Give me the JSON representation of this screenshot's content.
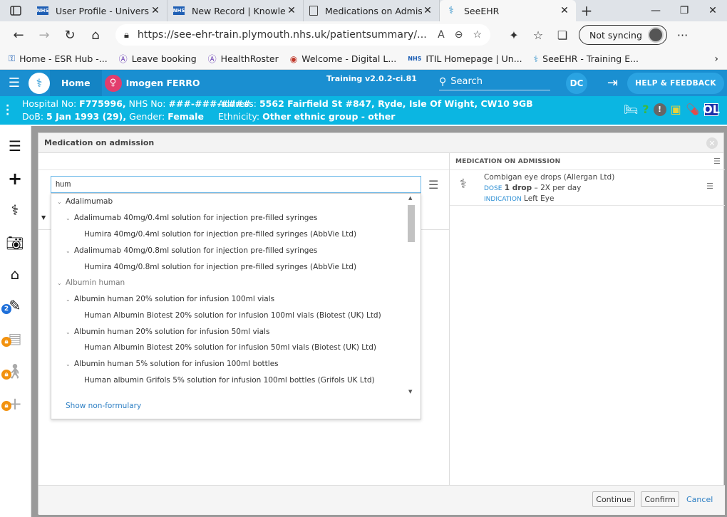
{
  "browser": {
    "tabs": [
      {
        "title": "User Profile - University",
        "favicon": "NHS",
        "active": false
      },
      {
        "title": "New Record | Knowledg",
        "favicon": "NHS",
        "active": false
      },
      {
        "title": "Medications on Admiss",
        "favicon": "doc",
        "active": false
      },
      {
        "title": "SeeEHR",
        "favicon": "drop",
        "active": true
      }
    ],
    "url": "https://see-ehr-train.plymouth.nhs.uk/patientsummary/...",
    "sync_label": "Not syncing",
    "bookmarks": [
      "Home - ESR Hub -...",
      "Leave booking",
      "HealthRoster",
      "Welcome - Digital L...",
      "ITIL Homepage | Un...",
      "SeeEHR - Training E..."
    ]
  },
  "app": {
    "home_label": "Home",
    "patient_name": "Imogen FERRO",
    "training_label": "Training v2.0.2-ci.81",
    "search_label": "Search",
    "user_initials": "DC",
    "help_label": "HELP & FEEDBACK"
  },
  "patient": {
    "hospital_label": "Hospital No:",
    "hospital_no": "F775996,",
    "nhs_label": "NHS No:",
    "nhs_no": "###-###-####",
    "dob_label": "DoB:",
    "dob": "5 Jan 1993 (29),",
    "gender_label": "Gender:",
    "gender": "Female",
    "address_label": "Address:",
    "address": "5562 Fairfield St #847, Ryde, Isle Of Wight, CW10 9GB",
    "ethnicity_label": "Ethnicity:",
    "ethnicity": "Other ethnic group - other",
    "ol_badge": "OL"
  },
  "rail": {
    "badge_count": "2"
  },
  "modal": {
    "title": "Medication on admission",
    "search_value": "hum",
    "results": [
      {
        "label": "Adalimumab",
        "level": 0,
        "type": "grp_active"
      },
      {
        "label": "Adalimumab 40mg/0.4ml solution for injection pre-filled syringes",
        "level": 1
      },
      {
        "label": "Humira 40mg/0.4ml solution for injection pre-filled syringes (AbbVie Ltd)",
        "level": 2
      },
      {
        "label": "Adalimumab 40mg/0.8ml solution for injection pre-filled syringes",
        "level": 1
      },
      {
        "label": "Humira 40mg/0.8ml solution for injection pre-filled syringes (AbbVie Ltd)",
        "level": 2
      },
      {
        "label": "Albumin human",
        "level": 0,
        "type": "grp"
      },
      {
        "label": "Albumin human 20% solution for infusion 100ml vials",
        "level": 1
      },
      {
        "label": "Human Albumin Biotest 20% solution for infusion 100ml vials (Biotest (UK) Ltd)",
        "level": 2
      },
      {
        "label": "Albumin human 20% solution for infusion 50ml vials",
        "level": 1
      },
      {
        "label": "Human Albumin Biotest 20% solution for infusion 50ml vials (Biotest (UK) Ltd)",
        "level": 2
      },
      {
        "label": "Albumin human 5% solution for infusion 100ml bottles",
        "level": 1
      },
      {
        "label": "Human albumin Grifols 5% solution for infusion 100ml bottles (Grifols UK Ltd)",
        "level": 2
      }
    ],
    "non_formulary_label": "Show non-formulary",
    "right_header": "MEDICATION ON ADMISSION",
    "medication": {
      "name": "Combigan eye drops (Allergan Ltd)",
      "dose_label": "DOSE",
      "dose_value": "1 drop",
      "dose_freq": "– 2X per day",
      "indication_label": "INDICATION",
      "indication_value": "Left Eye"
    },
    "continue_label": "Continue",
    "confirm_label": "Confirm",
    "cancel_label": "Cancel"
  }
}
